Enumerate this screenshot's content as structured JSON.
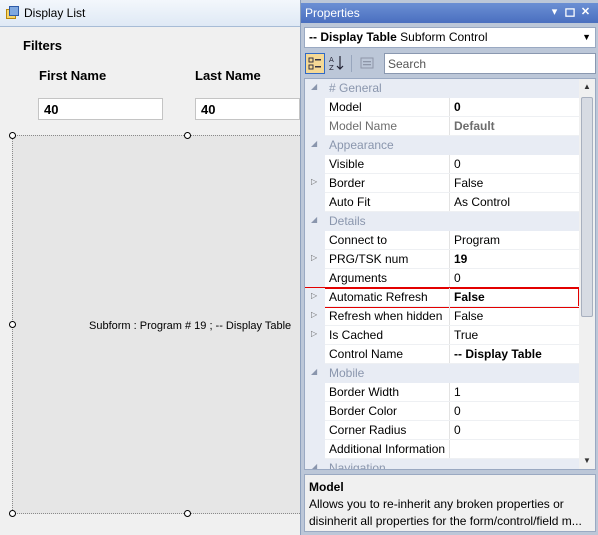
{
  "form": {
    "title": "Display List",
    "filters_legend": "Filters",
    "first_name_label": "First Name",
    "last_name_label": "Last Name",
    "first_name_value": "40",
    "last_name_value": "40",
    "subform_caption": "Subform :  Program # 19 ; -- Display Table"
  },
  "properties": {
    "title": "Properties",
    "selector": {
      "name": "-- Display Table",
      "type": "Subform Control"
    },
    "search_placeholder": "Search",
    "rows": [
      {
        "kind": "category",
        "label": "# General"
      },
      {
        "kind": "prop",
        "name": "Model",
        "value": "0",
        "bold": true
      },
      {
        "kind": "prop",
        "name": "Model Name",
        "value": "Default",
        "bold": true,
        "dim": true
      },
      {
        "kind": "category",
        "label": "Appearance"
      },
      {
        "kind": "prop",
        "name": "Visible",
        "value": "0"
      },
      {
        "kind": "prop",
        "name": "Border",
        "value": "False",
        "expandable": true
      },
      {
        "kind": "prop",
        "name": "Auto Fit",
        "value": "As Control"
      },
      {
        "kind": "category",
        "label": "Details"
      },
      {
        "kind": "prop",
        "name": "Connect to",
        "value": "Program"
      },
      {
        "kind": "prop",
        "name": "PRG/TSK num",
        "value": "19",
        "bold": true,
        "expandable": true
      },
      {
        "kind": "prop",
        "name": "Arguments",
        "value": "0"
      },
      {
        "kind": "prop",
        "name": "Automatic Refresh",
        "value": "False",
        "bold": true,
        "expandable": true,
        "highlighted": true
      },
      {
        "kind": "prop",
        "name": "Refresh when hidden",
        "value": "False",
        "expandable": true
      },
      {
        "kind": "prop",
        "name": "Is Cached",
        "value": "True",
        "expandable": true
      },
      {
        "kind": "prop",
        "name": "Control Name",
        "value": "-- Display Table",
        "bold": true
      },
      {
        "kind": "category",
        "label": "Mobile"
      },
      {
        "kind": "prop",
        "name": "Border Width",
        "value": "1"
      },
      {
        "kind": "prop",
        "name": "Border Color",
        "value": "0"
      },
      {
        "kind": "prop",
        "name": "Corner Radius",
        "value": "0"
      },
      {
        "kind": "prop",
        "name": "Additional Information",
        "value": ""
      },
      {
        "kind": "category",
        "label": "Navigation"
      }
    ],
    "description": {
      "title": "Model",
      "text": "Allows you to re-inherit any broken properties or disinherit all properties for the form/control/field m..."
    }
  },
  "colors": {
    "highlight_border": "#e30000",
    "title_bar": "#4a6fbf"
  }
}
